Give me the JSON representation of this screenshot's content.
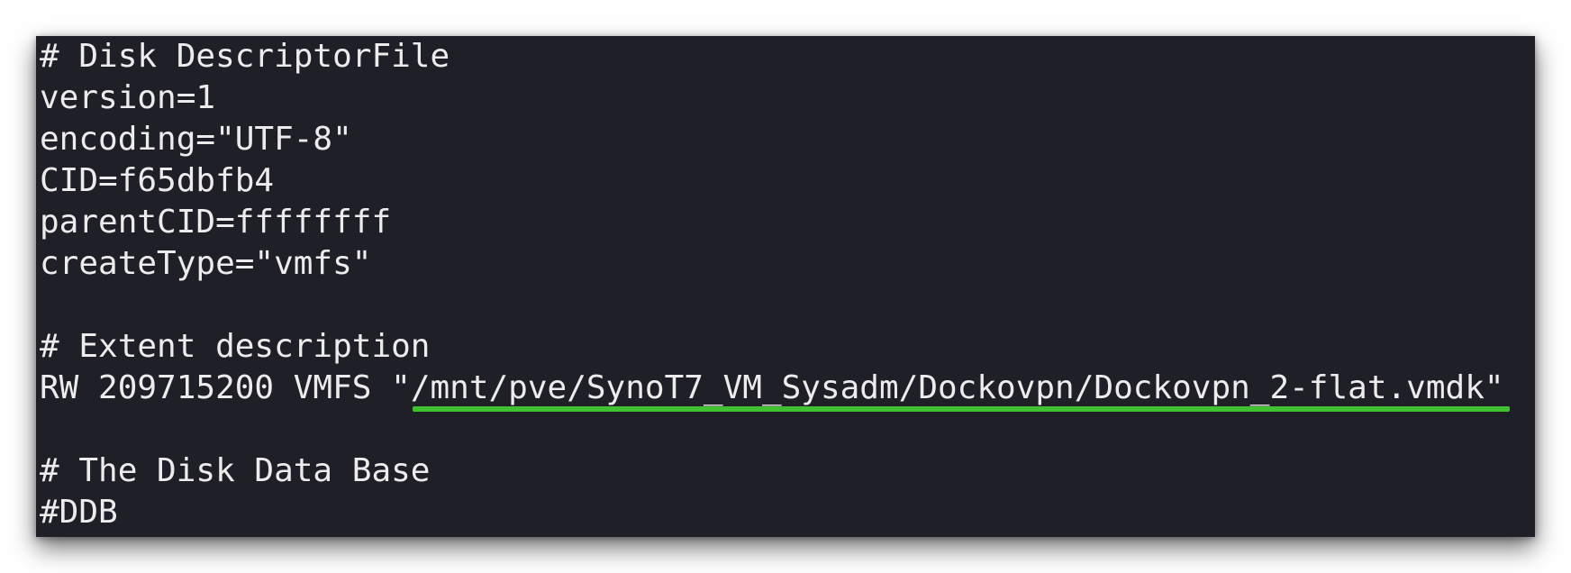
{
  "terminal": {
    "lines": {
      "header_comment": "# Disk DescriptorFile",
      "version": "version=1",
      "encoding": "encoding=\"UTF-8\"",
      "cid": "CID=f65dbfb4",
      "parent_cid": "parentCID=ffffffff",
      "create_type": "createType=\"vmfs\"",
      "extent_comment": "# Extent description",
      "extent_prefix": "RW 209715200 VMFS \"",
      "extent_path": "/mnt/pve/SynoT7_VM_Sysadm/Dockovpn/Dockovpn_2-flat.vmdk",
      "extent_suffix": "\"",
      "ddb_comment": "# The Disk Data Base",
      "ddb": "#DDB"
    },
    "colors": {
      "background": "#1f1f28",
      "text": "#ececec",
      "underline": "#3fc130"
    }
  }
}
